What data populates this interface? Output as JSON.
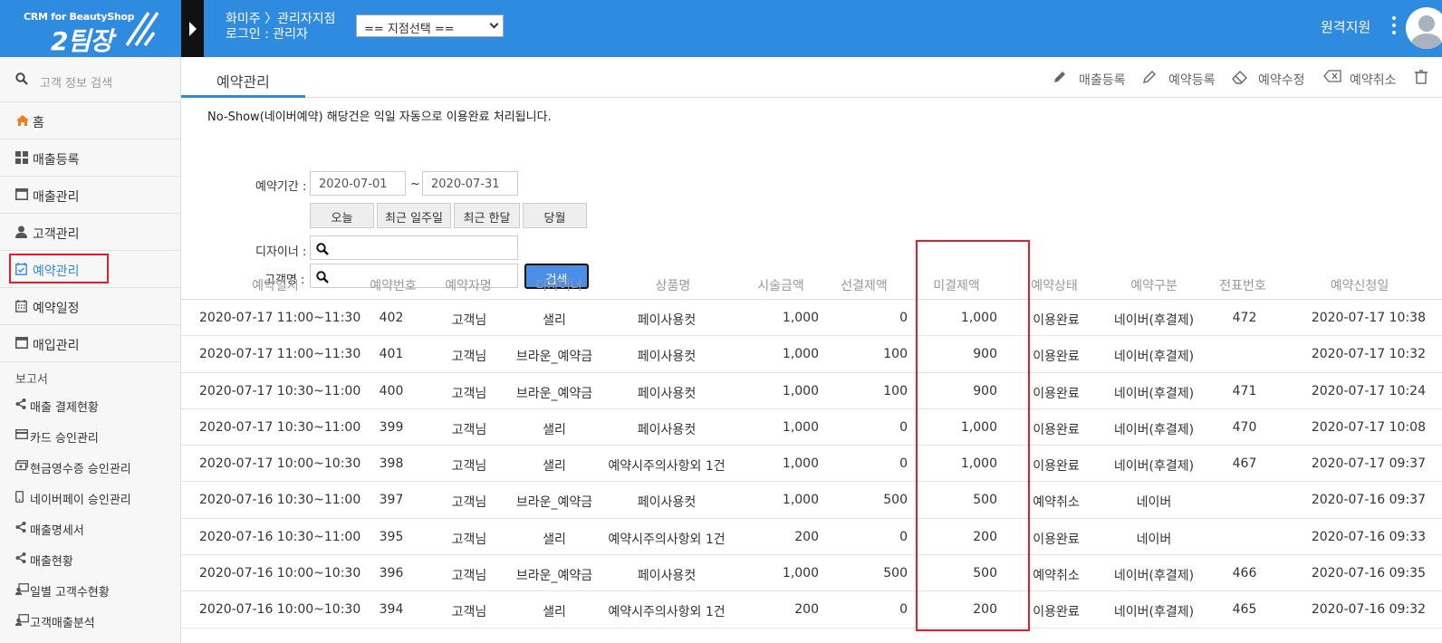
{
  "header": {
    "logo_sub": "CRM for BeautyShop",
    "logo_main": "2팀장",
    "store_line": "화미주 〉관리자지점",
    "login_line": "로그인 : 관리자",
    "branch_select": "== 지점선택 ==",
    "remote_support": "원격지원",
    "brand_color": "#2f8bdf"
  },
  "sidebar": {
    "search_placeholder": "고객 정보 검색",
    "items": [
      {
        "label": "홈",
        "icon": "home-icon"
      },
      {
        "label": "매출등록",
        "icon": "grid-icon"
      },
      {
        "label": "매출관리",
        "icon": "window-icon"
      },
      {
        "label": "고객관리",
        "icon": "user-icon"
      },
      {
        "label": "예약관리",
        "icon": "calendar-check-icon",
        "active": true
      },
      {
        "label": "예약일정",
        "icon": "calendar-icon"
      },
      {
        "label": "매입관리",
        "icon": "window-icon"
      }
    ],
    "report_section": "보고서",
    "reports": [
      {
        "label": "매출 결제현황",
        "icon": "share-icon"
      },
      {
        "label": "카드 승인관리",
        "icon": "credit-card-icon"
      },
      {
        "label": "현금영수증 승인관리",
        "icon": "cash-icon"
      },
      {
        "label": "네이버페이 승인관리",
        "icon": "mobile-icon"
      },
      {
        "label": "매출명세서",
        "icon": "share-icon"
      },
      {
        "label": "매출현황",
        "icon": "share-icon"
      },
      {
        "label": "일별 고객수현황",
        "icon": "users-chart-icon"
      },
      {
        "label": "고객매출분석",
        "icon": "users-chart-icon"
      }
    ]
  },
  "main": {
    "tab_title": "예약관리",
    "toolbar": {
      "sales_register": "매출등록",
      "reservation_register": "예약등록",
      "reservation_edit": "예약수정",
      "reservation_cancel": "예약취소"
    },
    "notice": "No-Show(네이버예약) 해당건은 익일 자동으로 이용완료 처리됩니다.",
    "filter": {
      "period_label": "예약기간 :",
      "date_from": "2020-07-01",
      "tilde": "~",
      "date_to": "2020-07-31",
      "quick": [
        "오늘",
        "최근 일주일",
        "최근 한달",
        "당월"
      ],
      "designer_label": "디자이너 :",
      "customer_label": "고객명 :",
      "search_button": "검색"
    },
    "table": {
      "columns": [
        "예약일시",
        "예약번호",
        "예약자명",
        "디자이너",
        "상품명",
        "시술금액",
        "선결제액",
        "미결제액",
        "예약상태",
        "예약구분",
        "전표번호",
        "예약신청일"
      ],
      "rows": [
        [
          "2020-07-17 11:00~11:30",
          "402",
          "고객님",
          "샐리",
          "페이사용컷",
          "1,000",
          "0",
          "1,000",
          "이용완료",
          "네이버(후결제)",
          "472",
          "2020-07-17 10:38"
        ],
        [
          "2020-07-17 11:00~11:30",
          "401",
          "고객님",
          "브라운_예약금",
          "페이사용컷",
          "1,000",
          "100",
          "900",
          "이용완료",
          "네이버(후결제)",
          "",
          "2020-07-17 10:32"
        ],
        [
          "2020-07-17 10:30~11:00",
          "400",
          "고객님",
          "브라운_예약금",
          "페이사용컷",
          "1,000",
          "100",
          "900",
          "이용완료",
          "네이버(후결제)",
          "471",
          "2020-07-17 10:24"
        ],
        [
          "2020-07-17 10:30~11:00",
          "399",
          "고객님",
          "샐리",
          "페이사용컷",
          "1,000",
          "0",
          "1,000",
          "이용완료",
          "네이버(후결제)",
          "470",
          "2020-07-17 10:08"
        ],
        [
          "2020-07-17 10:00~10:30",
          "398",
          "고객님",
          "샐리",
          "예약시주의사항외 1건",
          "1,000",
          "0",
          "1,000",
          "이용완료",
          "네이버(후결제)",
          "467",
          "2020-07-17 09:37"
        ],
        [
          "2020-07-16 10:30~11:00",
          "397",
          "고객님",
          "브라운_예약금",
          "페이사용컷",
          "1,000",
          "500",
          "500",
          "예약취소",
          "네이버",
          "",
          "2020-07-16 09:37"
        ],
        [
          "2020-07-16 10:30~11:00",
          "395",
          "고객님",
          "샐리",
          "예약시주의사항외 1건",
          "200",
          "0",
          "200",
          "이용완료",
          "네이버",
          "",
          "2020-07-16 09:33"
        ],
        [
          "2020-07-16 10:00~10:30",
          "396",
          "고객님",
          "브라운_예약금",
          "페이사용컷",
          "1,000",
          "500",
          "500",
          "예약취소",
          "네이버(후결제)",
          "466",
          "2020-07-16 09:35"
        ],
        [
          "2020-07-16 10:00~10:30",
          "394",
          "고객님",
          "샐리",
          "예약시주의사항외 1건",
          "200",
          "0",
          "200",
          "이용완료",
          "네이버(후결제)",
          "465",
          "2020-07-16 09:32"
        ]
      ]
    }
  }
}
